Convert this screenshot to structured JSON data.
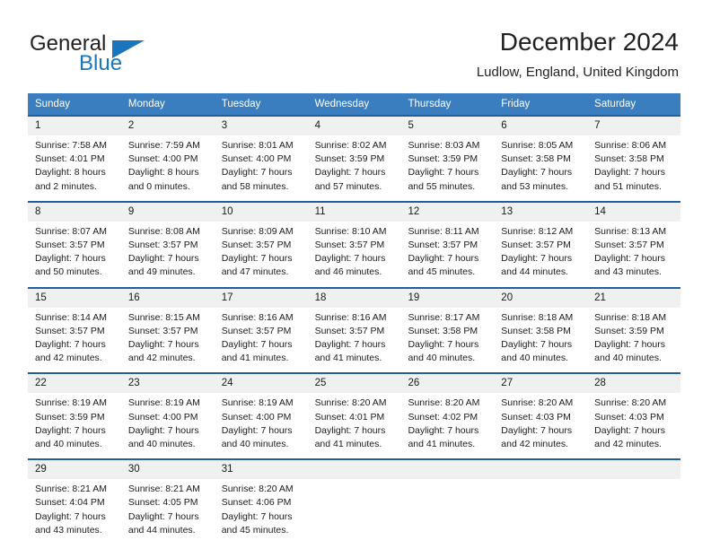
{
  "brand": {
    "name_part1": "General",
    "name_part2": "Blue",
    "flag_icon": "triangle-flag-icon"
  },
  "header": {
    "title": "December 2024",
    "subtitle": "Ludlow, England, United Kingdom"
  },
  "colors": {
    "header_bar": "#3b7ebf",
    "week_divider": "#1f5fa0",
    "daynum_bg": "#f0f0f0",
    "brand_blue": "#1b75bb",
    "text": "#1a1a1a"
  },
  "weekdays": [
    "Sunday",
    "Monday",
    "Tuesday",
    "Wednesday",
    "Thursday",
    "Friday",
    "Saturday"
  ],
  "weeks": [
    {
      "days": [
        {
          "date": "1",
          "sunrise": "Sunrise: 7:58 AM",
          "sunset": "Sunset: 4:01 PM",
          "daylight_line1": "Daylight: 8 hours",
          "daylight_line2": "and 2 minutes."
        },
        {
          "date": "2",
          "sunrise": "Sunrise: 7:59 AM",
          "sunset": "Sunset: 4:00 PM",
          "daylight_line1": "Daylight: 8 hours",
          "daylight_line2": "and 0 minutes."
        },
        {
          "date": "3",
          "sunrise": "Sunrise: 8:01 AM",
          "sunset": "Sunset: 4:00 PM",
          "daylight_line1": "Daylight: 7 hours",
          "daylight_line2": "and 58 minutes."
        },
        {
          "date": "4",
          "sunrise": "Sunrise: 8:02 AM",
          "sunset": "Sunset: 3:59 PM",
          "daylight_line1": "Daylight: 7 hours",
          "daylight_line2": "and 57 minutes."
        },
        {
          "date": "5",
          "sunrise": "Sunrise: 8:03 AM",
          "sunset": "Sunset: 3:59 PM",
          "daylight_line1": "Daylight: 7 hours",
          "daylight_line2": "and 55 minutes."
        },
        {
          "date": "6",
          "sunrise": "Sunrise: 8:05 AM",
          "sunset": "Sunset: 3:58 PM",
          "daylight_line1": "Daylight: 7 hours",
          "daylight_line2": "and 53 minutes."
        },
        {
          "date": "7",
          "sunrise": "Sunrise: 8:06 AM",
          "sunset": "Sunset: 3:58 PM",
          "daylight_line1": "Daylight: 7 hours",
          "daylight_line2": "and 51 minutes."
        }
      ]
    },
    {
      "days": [
        {
          "date": "8",
          "sunrise": "Sunrise: 8:07 AM",
          "sunset": "Sunset: 3:57 PM",
          "daylight_line1": "Daylight: 7 hours",
          "daylight_line2": "and 50 minutes."
        },
        {
          "date": "9",
          "sunrise": "Sunrise: 8:08 AM",
          "sunset": "Sunset: 3:57 PM",
          "daylight_line1": "Daylight: 7 hours",
          "daylight_line2": "and 49 minutes."
        },
        {
          "date": "10",
          "sunrise": "Sunrise: 8:09 AM",
          "sunset": "Sunset: 3:57 PM",
          "daylight_line1": "Daylight: 7 hours",
          "daylight_line2": "and 47 minutes."
        },
        {
          "date": "11",
          "sunrise": "Sunrise: 8:10 AM",
          "sunset": "Sunset: 3:57 PM",
          "daylight_line1": "Daylight: 7 hours",
          "daylight_line2": "and 46 minutes."
        },
        {
          "date": "12",
          "sunrise": "Sunrise: 8:11 AM",
          "sunset": "Sunset: 3:57 PM",
          "daylight_line1": "Daylight: 7 hours",
          "daylight_line2": "and 45 minutes."
        },
        {
          "date": "13",
          "sunrise": "Sunrise: 8:12 AM",
          "sunset": "Sunset: 3:57 PM",
          "daylight_line1": "Daylight: 7 hours",
          "daylight_line2": "and 44 minutes."
        },
        {
          "date": "14",
          "sunrise": "Sunrise: 8:13 AM",
          "sunset": "Sunset: 3:57 PM",
          "daylight_line1": "Daylight: 7 hours",
          "daylight_line2": "and 43 minutes."
        }
      ]
    },
    {
      "days": [
        {
          "date": "15",
          "sunrise": "Sunrise: 8:14 AM",
          "sunset": "Sunset: 3:57 PM",
          "daylight_line1": "Daylight: 7 hours",
          "daylight_line2": "and 42 minutes."
        },
        {
          "date": "16",
          "sunrise": "Sunrise: 8:15 AM",
          "sunset": "Sunset: 3:57 PM",
          "daylight_line1": "Daylight: 7 hours",
          "daylight_line2": "and 42 minutes."
        },
        {
          "date": "17",
          "sunrise": "Sunrise: 8:16 AM",
          "sunset": "Sunset: 3:57 PM",
          "daylight_line1": "Daylight: 7 hours",
          "daylight_line2": "and 41 minutes."
        },
        {
          "date": "18",
          "sunrise": "Sunrise: 8:16 AM",
          "sunset": "Sunset: 3:57 PM",
          "daylight_line1": "Daylight: 7 hours",
          "daylight_line2": "and 41 minutes."
        },
        {
          "date": "19",
          "sunrise": "Sunrise: 8:17 AM",
          "sunset": "Sunset: 3:58 PM",
          "daylight_line1": "Daylight: 7 hours",
          "daylight_line2": "and 40 minutes."
        },
        {
          "date": "20",
          "sunrise": "Sunrise: 8:18 AM",
          "sunset": "Sunset: 3:58 PM",
          "daylight_line1": "Daylight: 7 hours",
          "daylight_line2": "and 40 minutes."
        },
        {
          "date": "21",
          "sunrise": "Sunrise: 8:18 AM",
          "sunset": "Sunset: 3:59 PM",
          "daylight_line1": "Daylight: 7 hours",
          "daylight_line2": "and 40 minutes."
        }
      ]
    },
    {
      "days": [
        {
          "date": "22",
          "sunrise": "Sunrise: 8:19 AM",
          "sunset": "Sunset: 3:59 PM",
          "daylight_line1": "Daylight: 7 hours",
          "daylight_line2": "and 40 minutes."
        },
        {
          "date": "23",
          "sunrise": "Sunrise: 8:19 AM",
          "sunset": "Sunset: 4:00 PM",
          "daylight_line1": "Daylight: 7 hours",
          "daylight_line2": "and 40 minutes."
        },
        {
          "date": "24",
          "sunrise": "Sunrise: 8:19 AM",
          "sunset": "Sunset: 4:00 PM",
          "daylight_line1": "Daylight: 7 hours",
          "daylight_line2": "and 40 minutes."
        },
        {
          "date": "25",
          "sunrise": "Sunrise: 8:20 AM",
          "sunset": "Sunset: 4:01 PM",
          "daylight_line1": "Daylight: 7 hours",
          "daylight_line2": "and 41 minutes."
        },
        {
          "date": "26",
          "sunrise": "Sunrise: 8:20 AM",
          "sunset": "Sunset: 4:02 PM",
          "daylight_line1": "Daylight: 7 hours",
          "daylight_line2": "and 41 minutes."
        },
        {
          "date": "27",
          "sunrise": "Sunrise: 8:20 AM",
          "sunset": "Sunset: 4:03 PM",
          "daylight_line1": "Daylight: 7 hours",
          "daylight_line2": "and 42 minutes."
        },
        {
          "date": "28",
          "sunrise": "Sunrise: 8:20 AM",
          "sunset": "Sunset: 4:03 PM",
          "daylight_line1": "Daylight: 7 hours",
          "daylight_line2": "and 42 minutes."
        }
      ]
    },
    {
      "days": [
        {
          "date": "29",
          "sunrise": "Sunrise: 8:21 AM",
          "sunset": "Sunset: 4:04 PM",
          "daylight_line1": "Daylight: 7 hours",
          "daylight_line2": "and 43 minutes."
        },
        {
          "date": "30",
          "sunrise": "Sunrise: 8:21 AM",
          "sunset": "Sunset: 4:05 PM",
          "daylight_line1": "Daylight: 7 hours",
          "daylight_line2": "and 44 minutes."
        },
        {
          "date": "31",
          "sunrise": "Sunrise: 8:20 AM",
          "sunset": "Sunset: 4:06 PM",
          "daylight_line1": "Daylight: 7 hours",
          "daylight_line2": "and 45 minutes."
        },
        {
          "date": "",
          "sunrise": "",
          "sunset": "",
          "daylight_line1": "",
          "daylight_line2": ""
        },
        {
          "date": "",
          "sunrise": "",
          "sunset": "",
          "daylight_line1": "",
          "daylight_line2": ""
        },
        {
          "date": "",
          "sunrise": "",
          "sunset": "",
          "daylight_line1": "",
          "daylight_line2": ""
        },
        {
          "date": "",
          "sunrise": "",
          "sunset": "",
          "daylight_line1": "",
          "daylight_line2": ""
        }
      ]
    }
  ]
}
